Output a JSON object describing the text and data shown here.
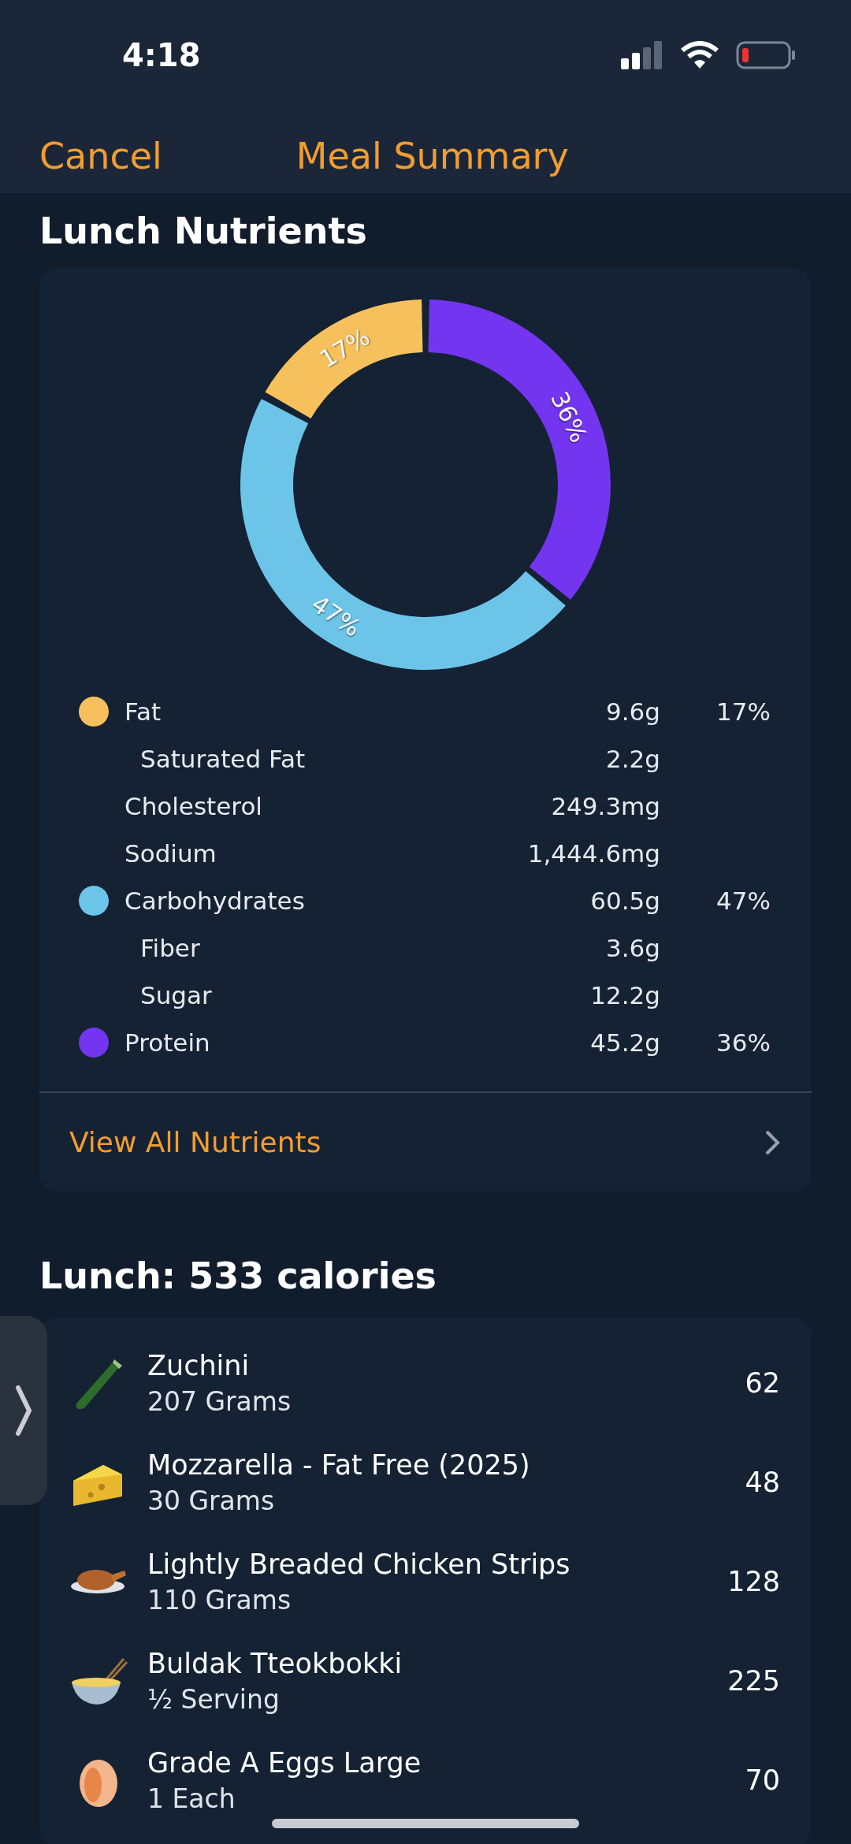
{
  "status_bar": {
    "time": "4:18"
  },
  "nav": {
    "cancel": "Cancel",
    "title": "Meal Summary"
  },
  "nutrients_section": {
    "title": "Lunch Nutrients",
    "chart_data": {
      "type": "donut",
      "values": [
        36,
        47,
        17
      ],
      "colors": [
        "#7335f0",
        "#6cc5e8",
        "#f6c15c"
      ],
      "value_labels": [
        "36%",
        "47%",
        "17%"
      ]
    },
    "rows": [
      {
        "kind": "macro",
        "label": "Fat",
        "amount": "9.6g",
        "percent": "17%",
        "color": "#f6c15c"
      },
      {
        "kind": "sub",
        "label": "Saturated Fat",
        "amount": "2.2g"
      },
      {
        "kind": "plain",
        "label": "Cholesterol",
        "amount": "249.3mg"
      },
      {
        "kind": "plain",
        "label": "Sodium",
        "amount": "1,444.6mg"
      },
      {
        "kind": "macro",
        "label": "Carbohydrates",
        "amount": "60.5g",
        "percent": "47%",
        "color": "#6cc5e8"
      },
      {
        "kind": "sub",
        "label": "Fiber",
        "amount": "3.6g"
      },
      {
        "kind": "sub",
        "label": "Sugar",
        "amount": "12.2g"
      },
      {
        "kind": "macro",
        "label": "Protein",
        "amount": "45.2g",
        "percent": "36%",
        "color": "#7335f0"
      }
    ],
    "link": "View All Nutrients"
  },
  "foods_section": {
    "title": "Lunch: 533 calories",
    "items": [
      {
        "kind": "zucchini",
        "name": "Zuchini",
        "amount": "207 Grams",
        "calories": "62"
      },
      {
        "kind": "cheese",
        "name": "Mozzarella - Fat Free (2025)",
        "amount": "30 Grams",
        "calories": "48"
      },
      {
        "kind": "chicken",
        "name": "Lightly Breaded Chicken Strips",
        "amount": "110 Grams",
        "calories": "128"
      },
      {
        "kind": "noodles",
        "name": "Buldak Tteokbokki",
        "amount": "½ Serving",
        "calories": "225"
      },
      {
        "kind": "egg",
        "name": "Grade A Eggs Large",
        "amount": "1 Each",
        "calories": "70"
      }
    ]
  }
}
